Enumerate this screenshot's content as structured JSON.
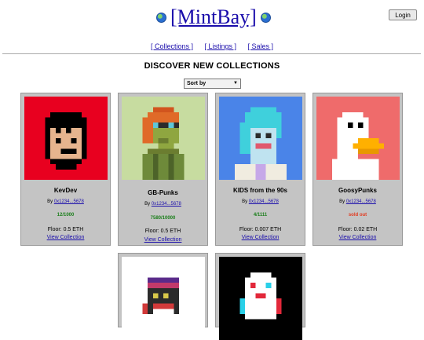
{
  "header": {
    "logo_text": "[MintBay]",
    "login_label": "Login"
  },
  "nav": {
    "collections": "[ Collections ]",
    "listings": "[ Listings ]",
    "sales": "[ Sales ]"
  },
  "page_title": "DISCOVER NEW COLLECTIONS",
  "sort": {
    "label": "Sort by"
  },
  "cards": [
    {
      "name": "KevDev",
      "by_prefix": "By",
      "owner": "0x1234...5678",
      "count": "12/1000",
      "count_status": "available",
      "floor": "Floor: 0.5 ETH",
      "view": "View Collection",
      "bg": "#e8001f"
    },
    {
      "name": "GB-Punks",
      "by_prefix": "By",
      "owner": "0x1234...5678",
      "count": "7580/10000",
      "count_status": "available",
      "floor": "Floor: 0.5 ETH",
      "view": "View Collection",
      "bg": "#c7dca0"
    },
    {
      "name": "KIDS from the 90s",
      "by_prefix": "By",
      "owner": "0x1234...5678",
      "count": "4/1111",
      "count_status": "available",
      "floor": "Floor: 0.007 ETH",
      "view": "View Collection",
      "bg": "#4a84e8"
    },
    {
      "name": "GoosyPunks",
      "by_prefix": "By",
      "owner": "0x1234...5678",
      "count": "sold out",
      "count_status": "sold",
      "floor": "Floor: 0.02 ETH",
      "view": "View Collection",
      "bg": "#ef6b6b"
    },
    {
      "name": "",
      "bg": "#ffffff"
    },
    {
      "name": "",
      "bg": "#000000"
    }
  ],
  "colors": {
    "link": "#1a0dab",
    "available": "#1b7f1b",
    "sold": "#e23a1f",
    "card_bg": "#c4c4c4"
  }
}
